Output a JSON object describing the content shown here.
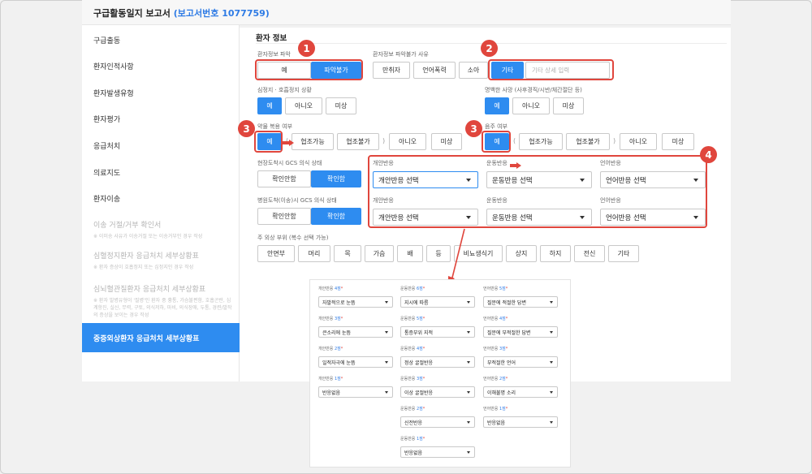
{
  "window": {
    "title": "구급활동일지 보고서",
    "report_no": "(보고서번호 1077759)"
  },
  "sidebar": {
    "items": [
      {
        "label": "구급출동"
      },
      {
        "label": "환자인적사항"
      },
      {
        "label": "환자발생유형"
      },
      {
        "label": "환자평가"
      },
      {
        "label": "응급처치"
      },
      {
        "label": "의료지도"
      },
      {
        "label": "환자이송"
      },
      {
        "label": "이송 거절/거부 확인서",
        "sub": "※ 이미송 사유가 이송거절 또는 이송거부인 경우 작성"
      },
      {
        "label": "심혈정지환자 응급처치 세부상황표",
        "sub": "※ 환자 증상이 호흡정지 또는 심정지인 경우 작성"
      },
      {
        "label": "심뇌혈관질환자 응급처치 세부상황표",
        "sub": "※ 환자 발병유형이 '질병'인 환자 중 흉통, 가슴불편함, 호흡곤란, 심계항진, 실신, 무력, 구토, 의식저하, 마비, 의식장애, 두통, 경련/발작의 증상을 보이는 경우 작성"
      },
      {
        "label": "중증외상환자 응급처치 세부상황표"
      }
    ]
  },
  "form": {
    "section_title": "환자 정보",
    "patient_info": {
      "label": "환자정보 파악",
      "options": [
        "예",
        "파악불가"
      ]
    },
    "unknown_reason": {
      "label": "환자정보 파악불가 사유",
      "options": [
        "만취자",
        "언어폭력",
        "소아",
        "기타"
      ],
      "placeholder": "기타 상세 입력"
    },
    "arrest": {
      "label": "심정지 · 호흡정지 상황",
      "options": [
        "예",
        "아니오",
        "미상"
      ]
    },
    "obvious_death": {
      "label": "명백한 사망 (사후경직/시반/체간절단 등)",
      "options": [
        "예",
        "아니오",
        "미상"
      ]
    },
    "drug": {
      "label": "약물 복용 여부",
      "options": [
        "예",
        "협조가능",
        "협조불가",
        "아니오",
        "미상"
      ]
    },
    "drinking": {
      "label": "음주 여부",
      "options": [
        "예",
        "협조가능",
        "협조불가",
        "아니오",
        "미상"
      ]
    },
    "gcs_scene": {
      "label": "현장도착시 GCS 의식 상태",
      "options": [
        "확인안함",
        "확인함"
      ]
    },
    "gcs_hospital": {
      "label": "병원도착(이송)시 GCS 의식 상태",
      "options": [
        "확인안함",
        "확인함"
      ]
    },
    "gcs": {
      "eye_label": "개안반응",
      "motor_label": "운동반응",
      "verbal_label": "언어반응",
      "eye_placeholder": "개안반응 선택",
      "motor_placeholder": "운동반응 선택",
      "verbal_placeholder": "언어반응 선택"
    },
    "injury": {
      "label": "주 외상 부위 (복수 선택 가능)",
      "options": [
        "안면부",
        "머리",
        "목",
        "가슴",
        "배",
        "등",
        "비뇨생식기",
        "상지",
        "하지",
        "전신",
        "기타"
      ]
    }
  },
  "annotations": {
    "badges": [
      "1",
      "2",
      "3",
      "3",
      "4"
    ]
  },
  "gcs_detail": {
    "eye": [
      {
        "label": "개안반응",
        "count": "4점",
        "value": "자발적으로 눈뜸"
      },
      {
        "label": "개안반응",
        "count": "3점",
        "value": "큰소리에 눈뜸"
      },
      {
        "label": "개안반응",
        "count": "2점",
        "value": "일적자극에 눈뜸"
      },
      {
        "label": "개안반응",
        "count": "1점",
        "value": "반응없음"
      }
    ],
    "motor": [
      {
        "label": "운동반응",
        "count": "6점",
        "value": "지시에 따름"
      },
      {
        "label": "운동반응",
        "count": "5점",
        "value": "통증부위 지적"
      },
      {
        "label": "운동반응",
        "count": "4점",
        "value": "정상 굴절반응"
      },
      {
        "label": "운동반응",
        "count": "3점",
        "value": "이상 굴절반응"
      },
      {
        "label": "운동반응",
        "count": "2점",
        "value": "신전반응"
      },
      {
        "label": "운동반응",
        "count": "1점",
        "value": "반응없음"
      }
    ],
    "verbal": [
      {
        "label": "언어반응",
        "count": "5점",
        "value": "질문에 적절한 답변"
      },
      {
        "label": "언어반응",
        "count": "4점",
        "value": "질문에 부적절한 답변"
      },
      {
        "label": "언어반응",
        "count": "3점",
        "value": "부적절한 언어"
      },
      {
        "label": "언어반응",
        "count": "2점",
        "value": "이해불명 소리"
      },
      {
        "label": "언어반응",
        "count": "1점",
        "value": "반응없음"
      }
    ],
    "required_mark": "*"
  },
  "colors": {
    "accent": "#2e8cf0",
    "annotation": "#e0463d"
  }
}
